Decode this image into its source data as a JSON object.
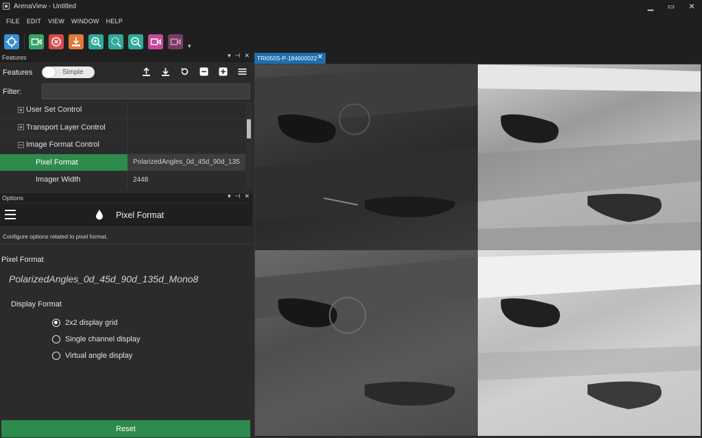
{
  "window": {
    "title": "ArenaView - Untitled",
    "minimize": "▁",
    "restore": "▭",
    "close": "✕"
  },
  "menu": [
    "FILE",
    "EDIT",
    "VIEW",
    "WINDOW",
    "HELP"
  ],
  "toolbar": {
    "more": "▾",
    "tools": [
      {
        "name": "connect-icon",
        "color": "#3a8fd6"
      },
      {
        "name": "start-stream-icon",
        "color": "#3aa36a"
      },
      {
        "name": "stop-icon",
        "color": "#d64a4a"
      },
      {
        "name": "save-image-icon",
        "color": "#e07a3a"
      },
      {
        "name": "zoom-in-icon",
        "color": "#2fa99a"
      },
      {
        "name": "zoom-fit-icon",
        "color": "#2fa99a"
      },
      {
        "name": "zoom-out-icon",
        "color": "#2fa99a"
      },
      {
        "name": "record-icon",
        "color": "#c84a9a"
      },
      {
        "name": "record-disabled-icon",
        "color": "#7a3a66"
      }
    ]
  },
  "features_panel": {
    "dock_title": "Features",
    "label": "Features",
    "mode_toggle": "Simple",
    "filter_label": "Filter:",
    "filter_value": "",
    "rows": [
      {
        "name": "User Set Control",
        "value": "",
        "type": "category-collapsed"
      },
      {
        "name": "Transport Layer Control",
        "value": "",
        "type": "category-collapsed"
      },
      {
        "name": "Image Format Control",
        "value": "",
        "type": "category-expanded"
      },
      {
        "name": "Pixel Format",
        "value": "PolarizedAngles_0d_45d_90d_135",
        "type": "leaf-selected"
      },
      {
        "name": "Imager Width",
        "value": "2448",
        "type": "leaf"
      }
    ]
  },
  "options_panel": {
    "dock_title": "Options",
    "title": "Pixel Format",
    "description": "Configure options related to pixel format.",
    "field_label": "Pixel Format",
    "field_value": "PolarizedAngles_0d_45d_90d_135d_Mono8",
    "display_format_label": "Display Format",
    "display_options": [
      {
        "label": "2x2 display grid",
        "checked": true
      },
      {
        "label": "Single channel display",
        "checked": false
      },
      {
        "label": "Virtual angle display",
        "checked": false
      }
    ],
    "reset_label": "Reset"
  },
  "viewer": {
    "tab_label": "TRI050S-P-184600022",
    "tab_close": "✕"
  },
  "dock_buttons": {
    "menu": "▾",
    "pin": "⊣",
    "close": "✕"
  },
  "colors": {
    "accent_green": "#2e8b4e",
    "tab_blue": "#1d6fb0",
    "panel_bg": "#2b2b2b",
    "chrome_bg": "#1f1f1f"
  }
}
